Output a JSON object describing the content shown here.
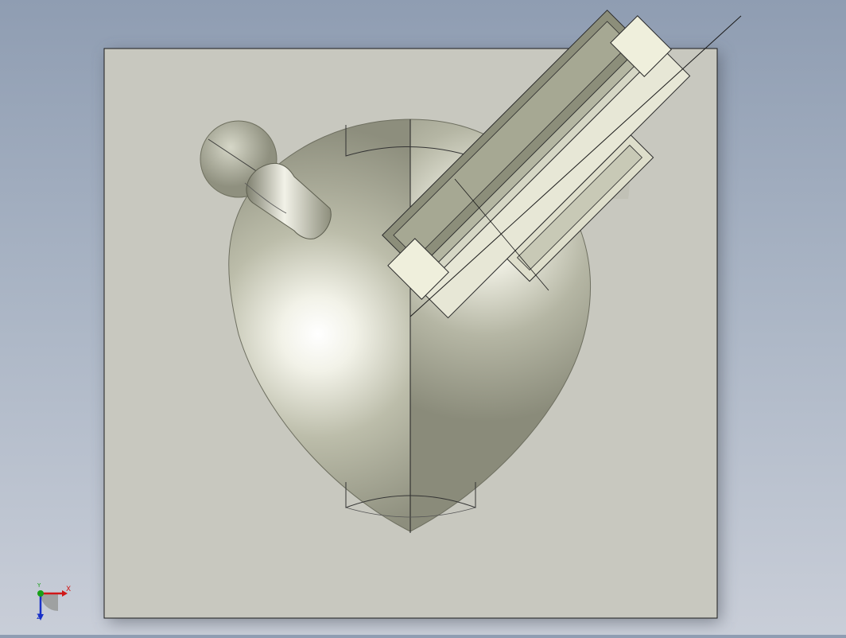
{
  "viewport": {
    "background_top": "#8f9db2",
    "background_bottom": "#c9ced8",
    "sheet_color": "#c8c8bf"
  },
  "model": {
    "surface_color": "#b8b9a8",
    "highlight_color": "#ffffff",
    "clip_light_color": "#eeeedc",
    "clip_dark_color": "#8c8e7a"
  },
  "triad": {
    "x_label": "X",
    "y_label": "Y",
    "z_label": "Z",
    "x_color": "#d01818",
    "y_color": "#18a018",
    "z_color": "#1830c8"
  }
}
